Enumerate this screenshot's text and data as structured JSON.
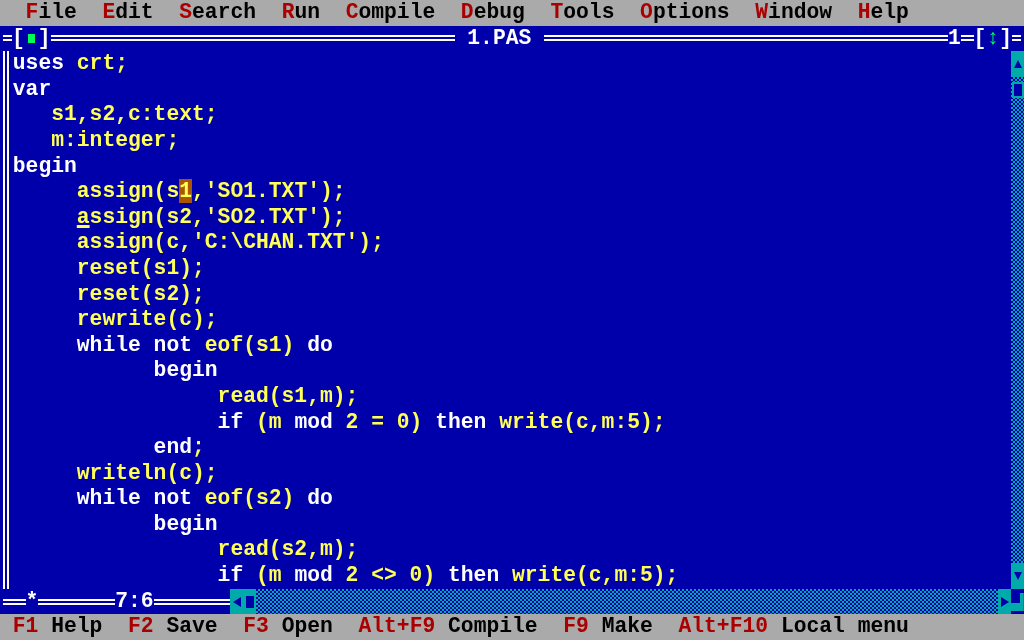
{
  "menu_bar": [
    {
      "hotkey": "F",
      "rest": "ile"
    },
    {
      "hotkey": "E",
      "rest": "dit"
    },
    {
      "hotkey": "S",
      "rest": "earch"
    },
    {
      "hotkey": "R",
      "rest": "un"
    },
    {
      "hotkey": "C",
      "rest": "ompile"
    },
    {
      "hotkey": "D",
      "rest": "ebug"
    },
    {
      "hotkey": "T",
      "rest": "ools"
    },
    {
      "hotkey": "O",
      "rest": "ptions"
    },
    {
      "hotkey": "W",
      "rest": "indow"
    },
    {
      "hotkey": "H",
      "rest": "elp"
    }
  ],
  "window": {
    "title": "1.PAS",
    "close_box": {
      "left": "[",
      "right": "]"
    },
    "number": "1",
    "zoom_box": {
      "left": "[",
      "glyph": "↕",
      "right": "]"
    },
    "modified_marker": "*",
    "cursor_position": "7:6",
    "lines": [
      [
        {
          "kind": "keyword",
          "text": "uses"
        },
        {
          "kind": "ident",
          "text": " crt;"
        }
      ],
      [
        {
          "kind": "keyword",
          "text": "var"
        }
      ],
      [
        {
          "kind": "ident",
          "text": "   s1,s2,c:text;"
        }
      ],
      [
        {
          "kind": "ident",
          "text": "   m:integer;"
        }
      ],
      [
        {
          "kind": "keyword",
          "text": "begin"
        }
      ],
      [
        {
          "kind": "ident",
          "text": "     assign(s"
        },
        {
          "kind": "cursor",
          "text": "1"
        },
        {
          "kind": "ident",
          "text": ",'SO1.TXT');"
        }
      ],
      [
        {
          "kind": "caret",
          "text": "     a"
        },
        {
          "kind": "ident",
          "text": "ssign(s2,'SO2.TXT');"
        }
      ],
      [
        {
          "kind": "ident",
          "text": "     assign(c,'C:\\CHAN.TXT');"
        }
      ],
      [
        {
          "kind": "ident",
          "text": "     reset(s1);"
        }
      ],
      [
        {
          "kind": "ident",
          "text": "     reset(s2);"
        }
      ],
      [
        {
          "kind": "ident",
          "text": "     rewrite(c);"
        }
      ],
      [
        {
          "kind": "keyword",
          "text": "     while not"
        },
        {
          "kind": "ident",
          "text": " eof(s1) "
        },
        {
          "kind": "keyword",
          "text": "do"
        }
      ],
      [
        {
          "kind": "keyword",
          "text": "           begin"
        }
      ],
      [
        {
          "kind": "ident",
          "text": "                read(s1,m);"
        }
      ],
      [
        {
          "kind": "keyword",
          "text": "                if"
        },
        {
          "kind": "ident",
          "text": " (m "
        },
        {
          "kind": "keyword",
          "text": "mod"
        },
        {
          "kind": "ident",
          "text": " 2 = 0) "
        },
        {
          "kind": "keyword",
          "text": "then"
        },
        {
          "kind": "ident",
          "text": " write(c,m:5);"
        }
      ],
      [
        {
          "kind": "keyword",
          "text": "           end"
        },
        {
          "kind": "ident",
          "text": ";"
        }
      ],
      [
        {
          "kind": "ident",
          "text": "     writeln(c);"
        }
      ],
      [
        {
          "kind": "keyword",
          "text": "     while not"
        },
        {
          "kind": "ident",
          "text": " eof(s2) "
        },
        {
          "kind": "keyword",
          "text": "do"
        }
      ],
      [
        {
          "kind": "keyword",
          "text": "           begin"
        }
      ],
      [
        {
          "kind": "ident",
          "text": "                read(s2,m);"
        }
      ],
      [
        {
          "kind": "keyword",
          "text": "                if"
        },
        {
          "kind": "ident",
          "text": " (m "
        },
        {
          "kind": "keyword",
          "text": "mod"
        },
        {
          "kind": "ident",
          "text": " 2 <> 0) "
        },
        {
          "kind": "keyword",
          "text": "then"
        },
        {
          "kind": "ident",
          "text": " write(c,m:5);"
        }
      ]
    ]
  },
  "status_bar": [
    {
      "key": "F1",
      "label": "Help"
    },
    {
      "key": "F2",
      "label": "Save"
    },
    {
      "key": "F3",
      "label": "Open"
    },
    {
      "key": "Alt+F9",
      "label": "Compile"
    },
    {
      "key": "F9",
      "label": "Make"
    },
    {
      "key": "Alt+F10",
      "label": "Local menu"
    }
  ]
}
